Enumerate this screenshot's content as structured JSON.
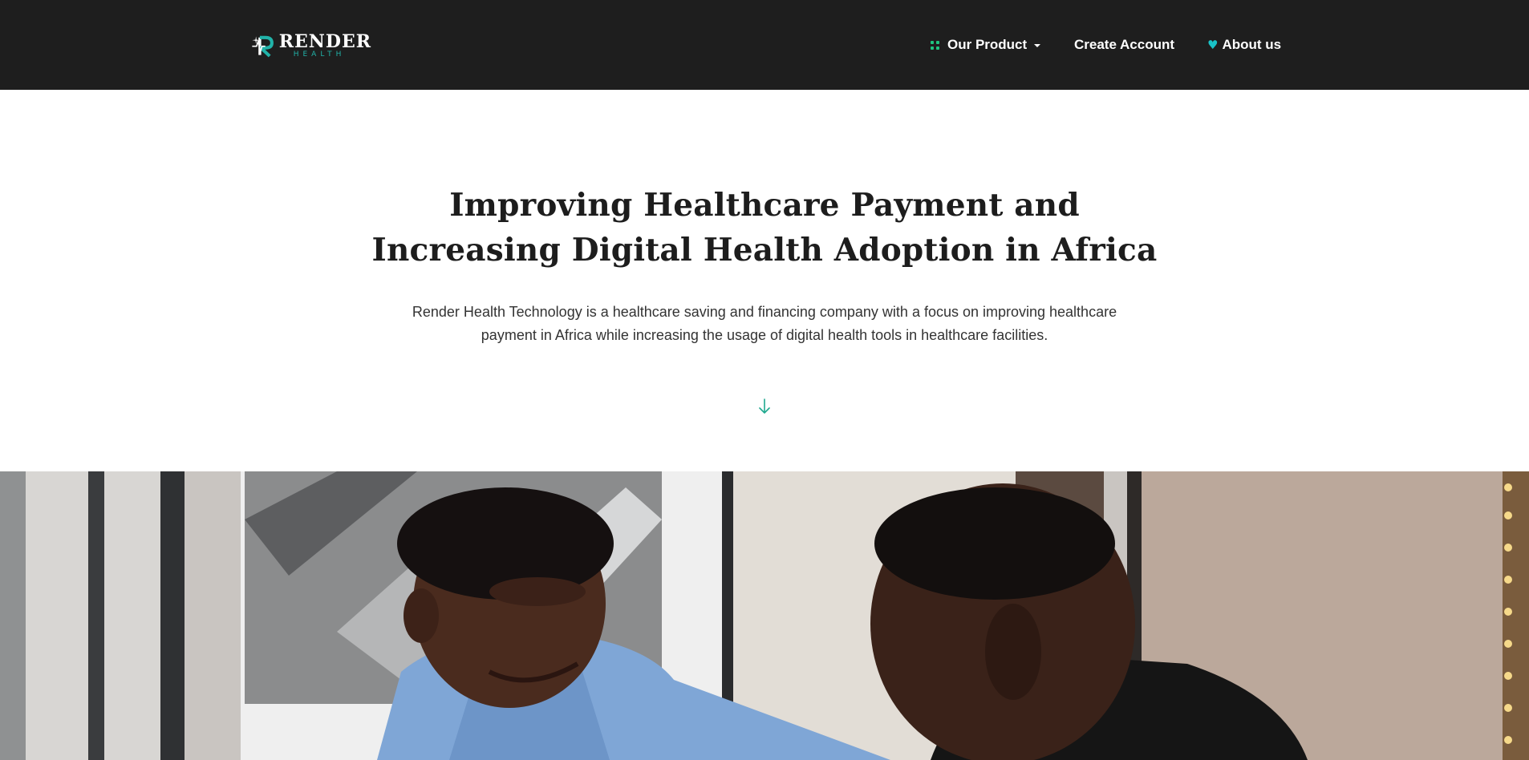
{
  "header": {
    "logo": {
      "word": "RENDER",
      "sub": "HEALTH"
    },
    "nav": {
      "product": {
        "label": "Our Product",
        "icon": "grid-icon",
        "trailing_icon": "caret-down-icon"
      },
      "create": {
        "label": "Create Account"
      },
      "about": {
        "label": "About us",
        "icon": "heart-icon"
      }
    }
  },
  "hero": {
    "title": "Improving Healthcare Payment and Increasing Digital Health Adoption in Africa",
    "text": "Render Health Technology is a healthcare saving and financing company with a focus on improving healthcare payment in Africa while increasing the usage of digital health tools in healthcare facilities.",
    "scroll_icon": "arrow-down-icon"
  },
  "colors": {
    "header_bg": "#1e1e1e",
    "brand_teal": "#21b3a9",
    "accent_green": "#1fc37f",
    "heart_cyan": "#19c3c8",
    "title": "#1d1d1d"
  }
}
